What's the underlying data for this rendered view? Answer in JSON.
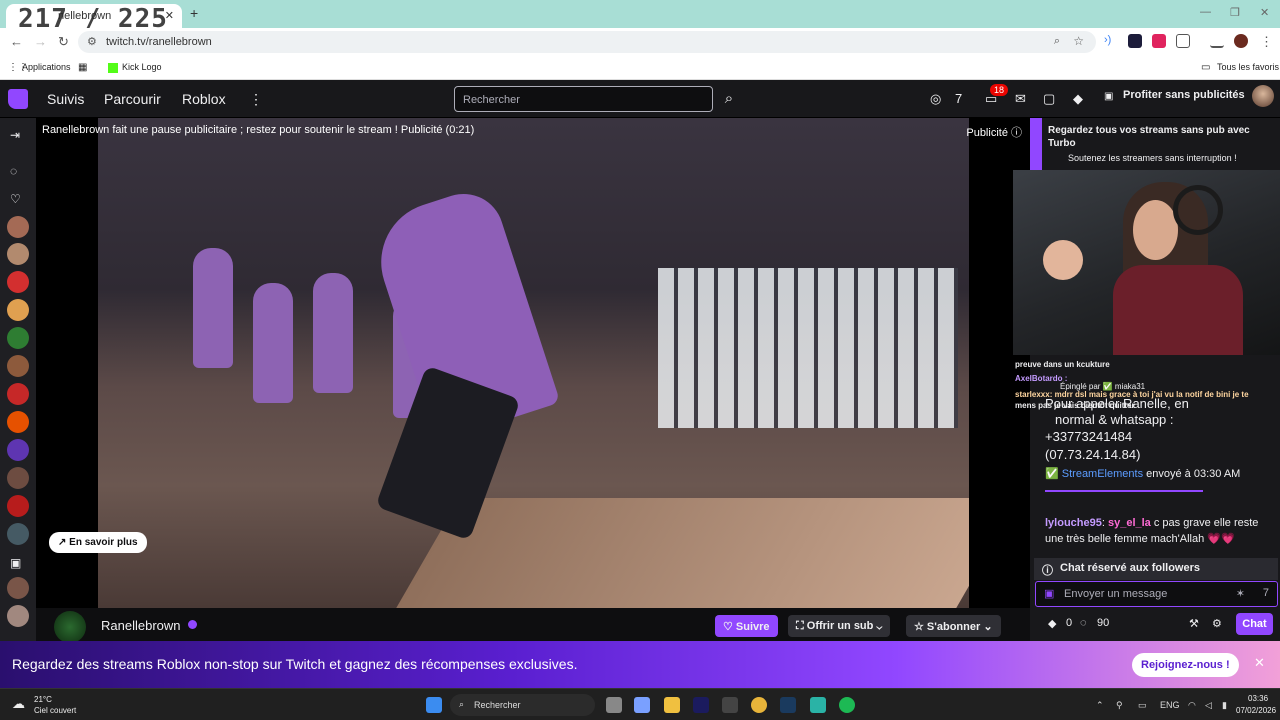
{
  "browser": {
    "tab_title": "nellebrown",
    "fps_overlay": "217 / 225",
    "new_tab": "+",
    "url": "twitch.tv/ranellebrown",
    "bookmarks": [
      "Applications",
      "Kick Logo"
    ],
    "all_favorites": "Tous les favoris"
  },
  "twitch_nav": {
    "links": [
      "Suivis",
      "Parcourir",
      "Roblox"
    ],
    "more": "⋮",
    "search_placeholder": "Rechercher",
    "notif_count": "18",
    "no_ads": "Profiter sans publicités"
  },
  "player": {
    "ad_message": "Ranellebrown fait une pause publicitaire ; restez pour soutenir le stream ! Publicité (0:21)",
    "ad_label": "Publicité",
    "learn_more": "En savoir plus"
  },
  "channel": {
    "name": "Ranellebrown",
    "follow": "Suivre",
    "gift_sub": "Offrir un sub",
    "subscribe": "S'abonner"
  },
  "chat": {
    "turbo_title": "Regardez tous vos streams sans pub avec Turbo",
    "turbo_sub": "Soutenez les streamers sans interruption !",
    "messages": [
      {
        "text": "preuve dans un kcukture"
      },
      {
        "text": "AxelBotardo :"
      },
      {
        "text": "Épinglé par ✅ miaka31"
      },
      {
        "text": "starlexxx: mdrr dsl mais grace à toi j'ai vu la notif de bini je te"
      },
      {
        "text": "mens pas je vais bientôt quitter"
      }
    ],
    "pinned_lines": [
      "Pour appeler Ranelle, en",
      "normal & whatsapp :",
      "+33773241484",
      "(07.73.24.14.84)"
    ],
    "bot_name": "StreamElements",
    "bot_sent": "envoyé à 03:30 AM",
    "lylouche_user": "lylouche95",
    "lylouche_mention": "sy_el_la",
    "lylouche_text": "c pas grave elle reste une très belle femme mach'Allah 💗💗",
    "followers_only": "Chat réservé aux followers",
    "input_placeholder": "Envoyer un message",
    "points": "0",
    "bits": "90",
    "chat_button": "Chat"
  },
  "promo": {
    "text": "Regardez des streams Roblox non-stop sur Twitch et gagnez des récompenses exclusives.",
    "join": "Rejoignez-nous !",
    "close": "✕"
  },
  "taskbar": {
    "temp": "21°C",
    "weather": "Ciel couvert",
    "search": "Rechercher",
    "lang": "ENG",
    "time": "03:36",
    "date": "07/02/2026"
  }
}
